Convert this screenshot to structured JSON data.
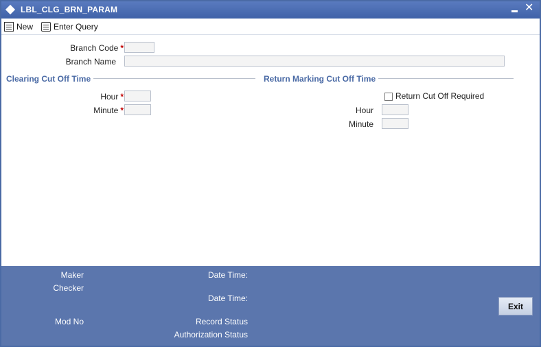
{
  "window": {
    "title": "LBL_CLG_BRN_PARAM"
  },
  "toolbar": {
    "new_label": "New",
    "enter_query_label": "Enter Query"
  },
  "form": {
    "branch_code_label": "Branch Code",
    "branch_name_label": "Branch Name",
    "branch_code_value": "",
    "branch_name_value": "",
    "required_marker": "*"
  },
  "clearing_section": {
    "title": "Clearing Cut Off Time",
    "hour_label": "Hour",
    "minute_label": "Minute",
    "hour_value": "",
    "minute_value": ""
  },
  "return_section": {
    "title": "Return Marking Cut Off Time",
    "checkbox_label": "Return Cut Off Required",
    "checkbox_checked": false,
    "hour_label": "Hour",
    "minute_label": "Minute",
    "hour_value": "",
    "minute_value": ""
  },
  "footer": {
    "maker_label": "Maker",
    "checker_label": "Checker",
    "mod_no_label": "Mod No",
    "maker_datetime_label": "Date Time:",
    "checker_datetime_label": "Date Time:",
    "record_status_label": "Record Status",
    "authorization_status_label": "Authorization Status",
    "exit_label": "Exit"
  },
  "colors": {
    "title_bar": "#4a6aa5",
    "section_title": "#4a6aa5",
    "footer": "#5b76ad",
    "required": "#c00000"
  }
}
